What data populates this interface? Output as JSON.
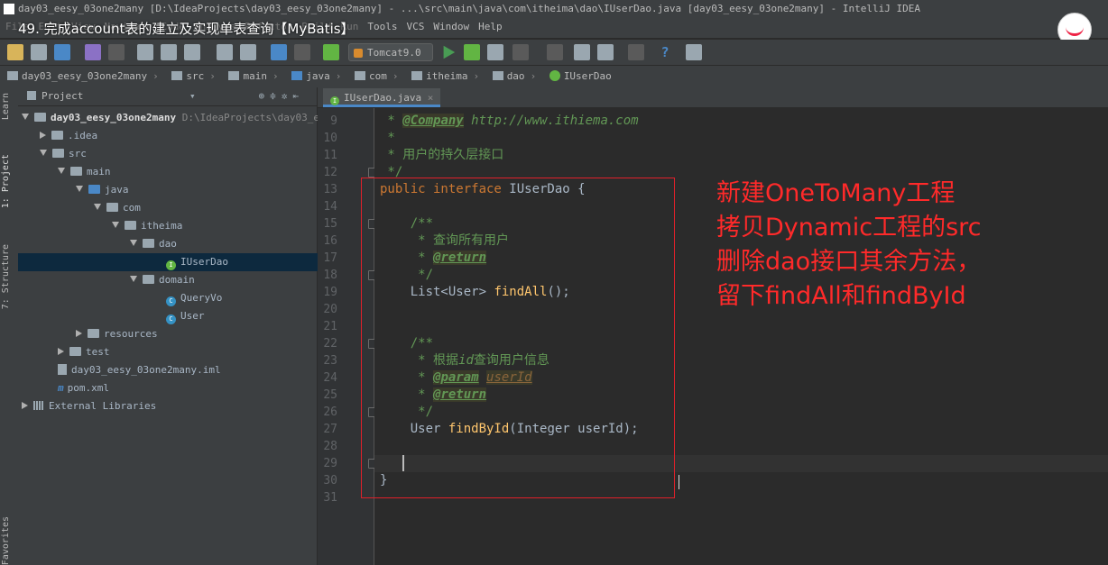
{
  "window": {
    "title": "day03_eesy_03one2many [D:\\IdeaProjects\\day03_eesy_03one2many] - ...\\src\\main\\java\\com\\itheima\\dao\\IUserDao.java [day03_eesy_03one2many] - IntelliJ IDEA"
  },
  "video_overlay": {
    "title": "49. 完成account表的建立及实现单表查询【MyBatis】"
  },
  "menu": {
    "items": [
      "File",
      "Edit",
      "View",
      "Navigate",
      "Code",
      "Analyze",
      "Refactor",
      "Build",
      "Run",
      "Tools",
      "VCS",
      "Window",
      "Help"
    ]
  },
  "toolbar": {
    "run_config": "Tomcat9.0"
  },
  "breadcrumb": {
    "items": [
      "day03_eesy_03one2many",
      "src",
      "main",
      "java",
      "com",
      "itheima",
      "dao",
      "IUserDao"
    ]
  },
  "side_tabs": {
    "learn": "Learn",
    "project": "1: Project",
    "structure": "7: Structure",
    "favorites": "Favorites"
  },
  "project_panel": {
    "header": "Project",
    "root_name": "day03_eesy_03one2many",
    "root_path": "D:\\IdeaProjects\\day03_e",
    "nodes": {
      "idea": ".idea",
      "src": "src",
      "main": "main",
      "java": "java",
      "com": "com",
      "itheima": "itheima",
      "dao": "dao",
      "iuserdao": "IUserDao",
      "domain": "domain",
      "queryvo": "QueryVo",
      "user": "User",
      "resources": "resources",
      "test": "test",
      "iml": "day03_eesy_03one2many.iml",
      "pom": "pom.xml",
      "external": "External Libraries"
    }
  },
  "editor": {
    "tab_label": "IUserDao.java",
    "line_numbers": [
      "9",
      "10",
      "11",
      "12",
      "13",
      "14",
      "15",
      "16",
      "17",
      "18",
      "19",
      "20",
      "21",
      "22",
      "23",
      "24",
      "25",
      "26",
      "27",
      "28",
      "29",
      "30",
      "31"
    ],
    "code": {
      "l9_tag": "@Company",
      "l9_url": " http://www.ithiema.com",
      "l11": " * 用户的持久层接口",
      "l12": " */",
      "l13_kw": "public interface",
      "l13_rest": " IUserDao {",
      "l15": "    /**",
      "l16": "     * 查询所有用户",
      "l17_tag": "@return",
      "l18": "     */",
      "l19_type": "    List<User> ",
      "l19_fn": "findAll",
      "l19_end": "();",
      "l22": "    /**",
      "l23_a": "     * 根据",
      "l23_b": "id",
      "l23_c": "查询用户信息",
      "l24_tag": "@param",
      "l24_param": "userId",
      "l25_tag": "@return",
      "l26": "     */",
      "l27_type": "    User ",
      "l27_fn": "findById",
      "l27_end": "(Integer userId);",
      "l30": "}"
    }
  },
  "annotation": {
    "color": "#ff2a2a",
    "lines": [
      "新建OneToMany工程",
      "拷贝Dynamic工程的src",
      "删除dao接口其余方法，",
      "留下findAll和findById"
    ]
  }
}
